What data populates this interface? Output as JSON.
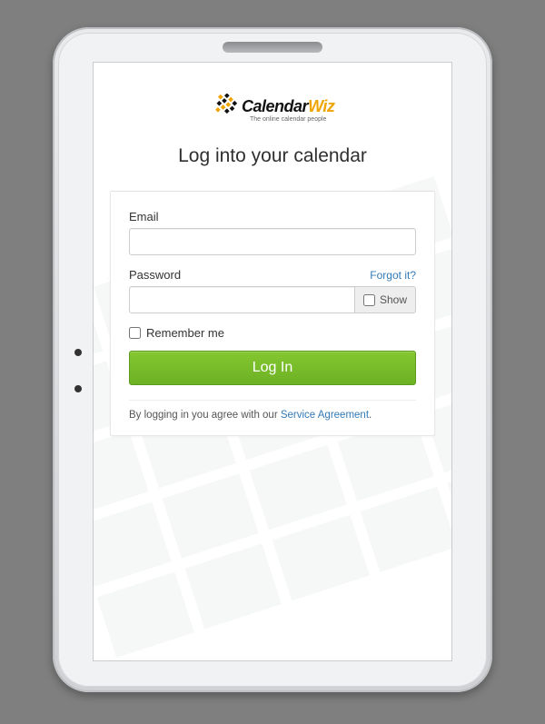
{
  "logo": {
    "name_part1": "Calendar",
    "name_part2": "Wiz",
    "tagline": "The online calendar people"
  },
  "page": {
    "title": "Log into your calendar"
  },
  "form": {
    "email_label": "Email",
    "password_label": "Password",
    "forgot_label": "Forgot it?",
    "show_label": "Show",
    "remember_label": "Remember me",
    "login_button": "Log In"
  },
  "footer": {
    "agreement_prefix": "By logging in you agree with our ",
    "agreement_link": "Service Agreement",
    "agreement_suffix": "."
  },
  "colors": {
    "accent_green": "#75b728",
    "accent_orange": "#f0a400",
    "link_blue": "#337ab7"
  }
}
